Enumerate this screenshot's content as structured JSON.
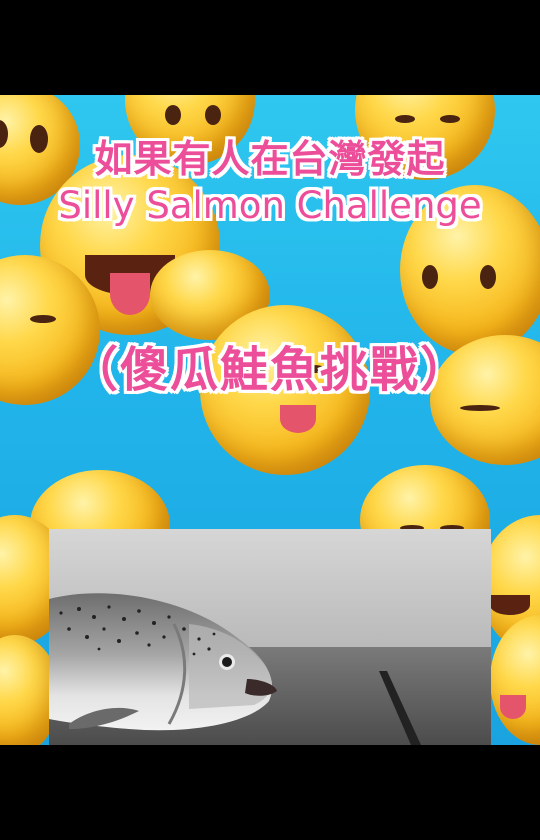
{
  "title": {
    "line1": "如果有人在台灣發起",
    "line2": "Silly Salmon Challenge",
    "line3": "（傻瓜鮭魚挑戰）"
  },
  "photo": {
    "subject": "salmon-head-on-counter"
  },
  "colors": {
    "background_top": "#2fc7ef",
    "background_bottom": "#1aa3e0",
    "title_pink": "#ec4e9a",
    "title_outline": "#ffffff",
    "emoji_yellow": "#ffd84a",
    "letterbox": "#000000"
  }
}
